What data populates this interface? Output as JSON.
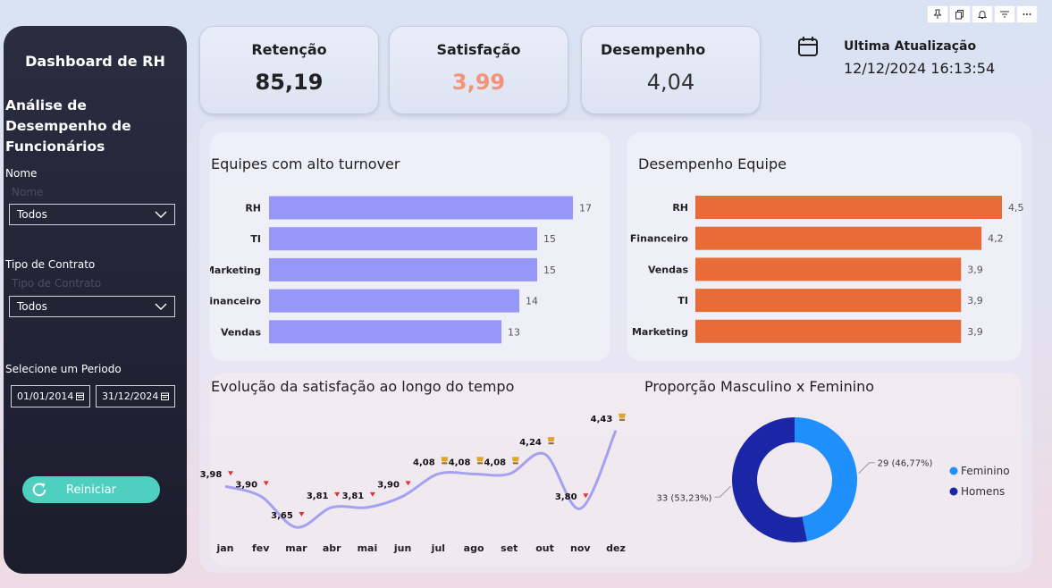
{
  "sidebar": {
    "title": "Dashboard de RH",
    "subtitle": "Análise de Desempenho de Funcionários",
    "filters": [
      {
        "label": "Nome",
        "ghost": "Nome",
        "value": "Todos"
      },
      {
        "label": "Tipo de Contrato",
        "ghost": "Tipo de Contrato",
        "value": "Todos"
      }
    ],
    "period_label": "Selecione um Periodo",
    "date_start": "01/01/2014",
    "date_end": "31/12/2024",
    "reset_label": "Reiniciar"
  },
  "kpis": [
    {
      "title": "Retenção",
      "value": "85,19",
      "color": "#222222"
    },
    {
      "title": "Satisfação",
      "value": "3,99",
      "color": "#f2937a"
    },
    {
      "title": "Desempenho",
      "value": "4,04",
      "color": "#333333"
    }
  ],
  "update": {
    "label": "Ultima Atualização",
    "value": "12/12/2024 16:13:54"
  },
  "toolbar": {
    "icons": [
      "pin-icon",
      "copy-icon",
      "bell-icon",
      "filter-icon",
      "more-icon"
    ]
  },
  "chart_data": [
    {
      "type": "bar",
      "orientation": "horizontal",
      "title": "Equipes com alto turnover",
      "categories": [
        "RH",
        "TI",
        "Marketing",
        "Financeiro",
        "Vendas"
      ],
      "values": [
        17,
        15,
        15,
        14,
        13
      ],
      "value_labels": [
        "17",
        "15",
        "15",
        "14",
        "13"
      ],
      "xlim": [
        0,
        17
      ],
      "color": "#9797f7"
    },
    {
      "type": "bar",
      "orientation": "horizontal",
      "title": "Desempenho Equipe",
      "categories": [
        "RH",
        "Financeiro",
        "Vendas",
        "TI",
        "Marketing"
      ],
      "values": [
        4.5,
        4.2,
        3.9,
        3.9,
        3.9
      ],
      "value_labels": [
        "4,5",
        "4,2",
        "3,9",
        "3,9",
        "3,9"
      ],
      "xlim": [
        0,
        4.5
      ],
      "color": "#e86c38"
    },
    {
      "type": "line",
      "title": "Evolução da satisfação ao longo do tempo",
      "categories": [
        "jan",
        "fev",
        "mar",
        "abr",
        "mai",
        "jun",
        "jul",
        "ago",
        "set",
        "out",
        "nov",
        "dez"
      ],
      "values": [
        3.98,
        3.9,
        3.65,
        3.81,
        3.81,
        3.9,
        4.08,
        4.08,
        4.08,
        4.24,
        3.8,
        4.43
      ],
      "value_labels": [
        "3,98",
        "3,90",
        "3,65",
        "3,81",
        "3,81",
        "3,90",
        "4,08",
        "4,08",
        "4,08",
        "4,24",
        "3,80",
        "4,43"
      ],
      "markers": [
        "down",
        "down",
        "down",
        "down",
        "down",
        "down",
        "trophy",
        "trophy",
        "trophy",
        "trophy",
        "down",
        "trophy"
      ],
      "color": "#a3a1f0"
    },
    {
      "type": "pie",
      "style": "donut",
      "title": "Proporção Masculino x Feminino",
      "slices": [
        {
          "name": "Feminino",
          "value": 29,
          "label": "29 (46,77%)",
          "color": "#1e8ffb"
        },
        {
          "name": "Homens",
          "value": 33,
          "label": "33 (53,23%)",
          "color": "#1a26a6"
        }
      ],
      "legend_position": "right"
    }
  ]
}
